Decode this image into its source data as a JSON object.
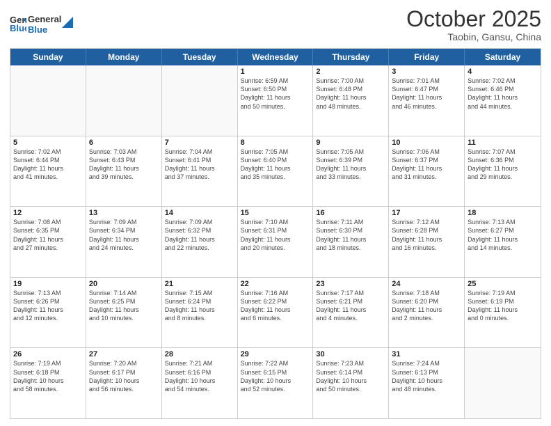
{
  "header": {
    "logo_line1": "General",
    "logo_line2": "Blue",
    "month": "October 2025",
    "location": "Taobin, Gansu, China"
  },
  "day_headers": [
    "Sunday",
    "Monday",
    "Tuesday",
    "Wednesday",
    "Thursday",
    "Friday",
    "Saturday"
  ],
  "weeks": [
    [
      {
        "day": "",
        "info": ""
      },
      {
        "day": "",
        "info": ""
      },
      {
        "day": "",
        "info": ""
      },
      {
        "day": "1",
        "info": "Sunrise: 6:59 AM\nSunset: 6:50 PM\nDaylight: 11 hours\nand 50 minutes."
      },
      {
        "day": "2",
        "info": "Sunrise: 7:00 AM\nSunset: 6:48 PM\nDaylight: 11 hours\nand 48 minutes."
      },
      {
        "day": "3",
        "info": "Sunrise: 7:01 AM\nSunset: 6:47 PM\nDaylight: 11 hours\nand 46 minutes."
      },
      {
        "day": "4",
        "info": "Sunrise: 7:02 AM\nSunset: 6:46 PM\nDaylight: 11 hours\nand 44 minutes."
      }
    ],
    [
      {
        "day": "5",
        "info": "Sunrise: 7:02 AM\nSunset: 6:44 PM\nDaylight: 11 hours\nand 41 minutes."
      },
      {
        "day": "6",
        "info": "Sunrise: 7:03 AM\nSunset: 6:43 PM\nDaylight: 11 hours\nand 39 minutes."
      },
      {
        "day": "7",
        "info": "Sunrise: 7:04 AM\nSunset: 6:41 PM\nDaylight: 11 hours\nand 37 minutes."
      },
      {
        "day": "8",
        "info": "Sunrise: 7:05 AM\nSunset: 6:40 PM\nDaylight: 11 hours\nand 35 minutes."
      },
      {
        "day": "9",
        "info": "Sunrise: 7:05 AM\nSunset: 6:39 PM\nDaylight: 11 hours\nand 33 minutes."
      },
      {
        "day": "10",
        "info": "Sunrise: 7:06 AM\nSunset: 6:37 PM\nDaylight: 11 hours\nand 31 minutes."
      },
      {
        "day": "11",
        "info": "Sunrise: 7:07 AM\nSunset: 6:36 PM\nDaylight: 11 hours\nand 29 minutes."
      }
    ],
    [
      {
        "day": "12",
        "info": "Sunrise: 7:08 AM\nSunset: 6:35 PM\nDaylight: 11 hours\nand 27 minutes."
      },
      {
        "day": "13",
        "info": "Sunrise: 7:09 AM\nSunset: 6:34 PM\nDaylight: 11 hours\nand 24 minutes."
      },
      {
        "day": "14",
        "info": "Sunrise: 7:09 AM\nSunset: 6:32 PM\nDaylight: 11 hours\nand 22 minutes."
      },
      {
        "day": "15",
        "info": "Sunrise: 7:10 AM\nSunset: 6:31 PM\nDaylight: 11 hours\nand 20 minutes."
      },
      {
        "day": "16",
        "info": "Sunrise: 7:11 AM\nSunset: 6:30 PM\nDaylight: 11 hours\nand 18 minutes."
      },
      {
        "day": "17",
        "info": "Sunrise: 7:12 AM\nSunset: 6:28 PM\nDaylight: 11 hours\nand 16 minutes."
      },
      {
        "day": "18",
        "info": "Sunrise: 7:13 AM\nSunset: 6:27 PM\nDaylight: 11 hours\nand 14 minutes."
      }
    ],
    [
      {
        "day": "19",
        "info": "Sunrise: 7:13 AM\nSunset: 6:26 PM\nDaylight: 11 hours\nand 12 minutes."
      },
      {
        "day": "20",
        "info": "Sunrise: 7:14 AM\nSunset: 6:25 PM\nDaylight: 11 hours\nand 10 minutes."
      },
      {
        "day": "21",
        "info": "Sunrise: 7:15 AM\nSunset: 6:24 PM\nDaylight: 11 hours\nand 8 minutes."
      },
      {
        "day": "22",
        "info": "Sunrise: 7:16 AM\nSunset: 6:22 PM\nDaylight: 11 hours\nand 6 minutes."
      },
      {
        "day": "23",
        "info": "Sunrise: 7:17 AM\nSunset: 6:21 PM\nDaylight: 11 hours\nand 4 minutes."
      },
      {
        "day": "24",
        "info": "Sunrise: 7:18 AM\nSunset: 6:20 PM\nDaylight: 11 hours\nand 2 minutes."
      },
      {
        "day": "25",
        "info": "Sunrise: 7:19 AM\nSunset: 6:19 PM\nDaylight: 11 hours\nand 0 minutes."
      }
    ],
    [
      {
        "day": "26",
        "info": "Sunrise: 7:19 AM\nSunset: 6:18 PM\nDaylight: 10 hours\nand 58 minutes."
      },
      {
        "day": "27",
        "info": "Sunrise: 7:20 AM\nSunset: 6:17 PM\nDaylight: 10 hours\nand 56 minutes."
      },
      {
        "day": "28",
        "info": "Sunrise: 7:21 AM\nSunset: 6:16 PM\nDaylight: 10 hours\nand 54 minutes."
      },
      {
        "day": "29",
        "info": "Sunrise: 7:22 AM\nSunset: 6:15 PM\nDaylight: 10 hours\nand 52 minutes."
      },
      {
        "day": "30",
        "info": "Sunrise: 7:23 AM\nSunset: 6:14 PM\nDaylight: 10 hours\nand 50 minutes."
      },
      {
        "day": "31",
        "info": "Sunrise: 7:24 AM\nSunset: 6:13 PM\nDaylight: 10 hours\nand 48 minutes."
      },
      {
        "day": "",
        "info": ""
      }
    ]
  ]
}
